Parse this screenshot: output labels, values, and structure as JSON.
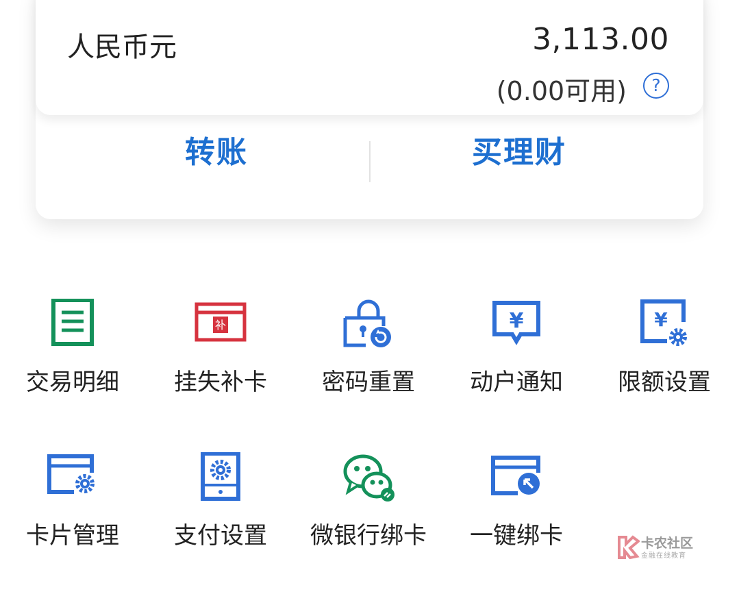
{
  "account": {
    "currency": "人民币元",
    "amount": "3,113.00",
    "available": "(0.00可用)",
    "help_icon": "?"
  },
  "actions": {
    "transfer": "转账",
    "wealth": "买理财"
  },
  "services": [
    {
      "label": "交易明细",
      "icon": "transaction-details-icon",
      "color": "#14915a"
    },
    {
      "label": "挂失补卡",
      "icon": "report-loss-card-icon",
      "color": "#d6333f",
      "badge": "补"
    },
    {
      "label": "密码重置",
      "icon": "password-reset-icon",
      "color": "#2f6fd6"
    },
    {
      "label": "动户通知",
      "icon": "account-notice-icon",
      "color": "#2f6fd6",
      "glyph": "¥"
    },
    {
      "label": "限额设置",
      "icon": "limit-settings-icon",
      "color": "#2f6fd6",
      "glyph": "¥"
    },
    {
      "label": "卡片管理",
      "icon": "card-management-icon",
      "color": "#2f6fd6"
    },
    {
      "label": "支付设置",
      "icon": "payment-settings-icon",
      "color": "#2f6fd6"
    },
    {
      "label": "微银行绑卡",
      "icon": "wechat-bind-card-icon",
      "color": "#14915a"
    },
    {
      "label": "一键绑卡",
      "icon": "one-click-bind-icon",
      "color": "#2f6fd6"
    }
  ],
  "watermark": {
    "title": "卡农社区",
    "subtitle": "金融在线教育"
  }
}
